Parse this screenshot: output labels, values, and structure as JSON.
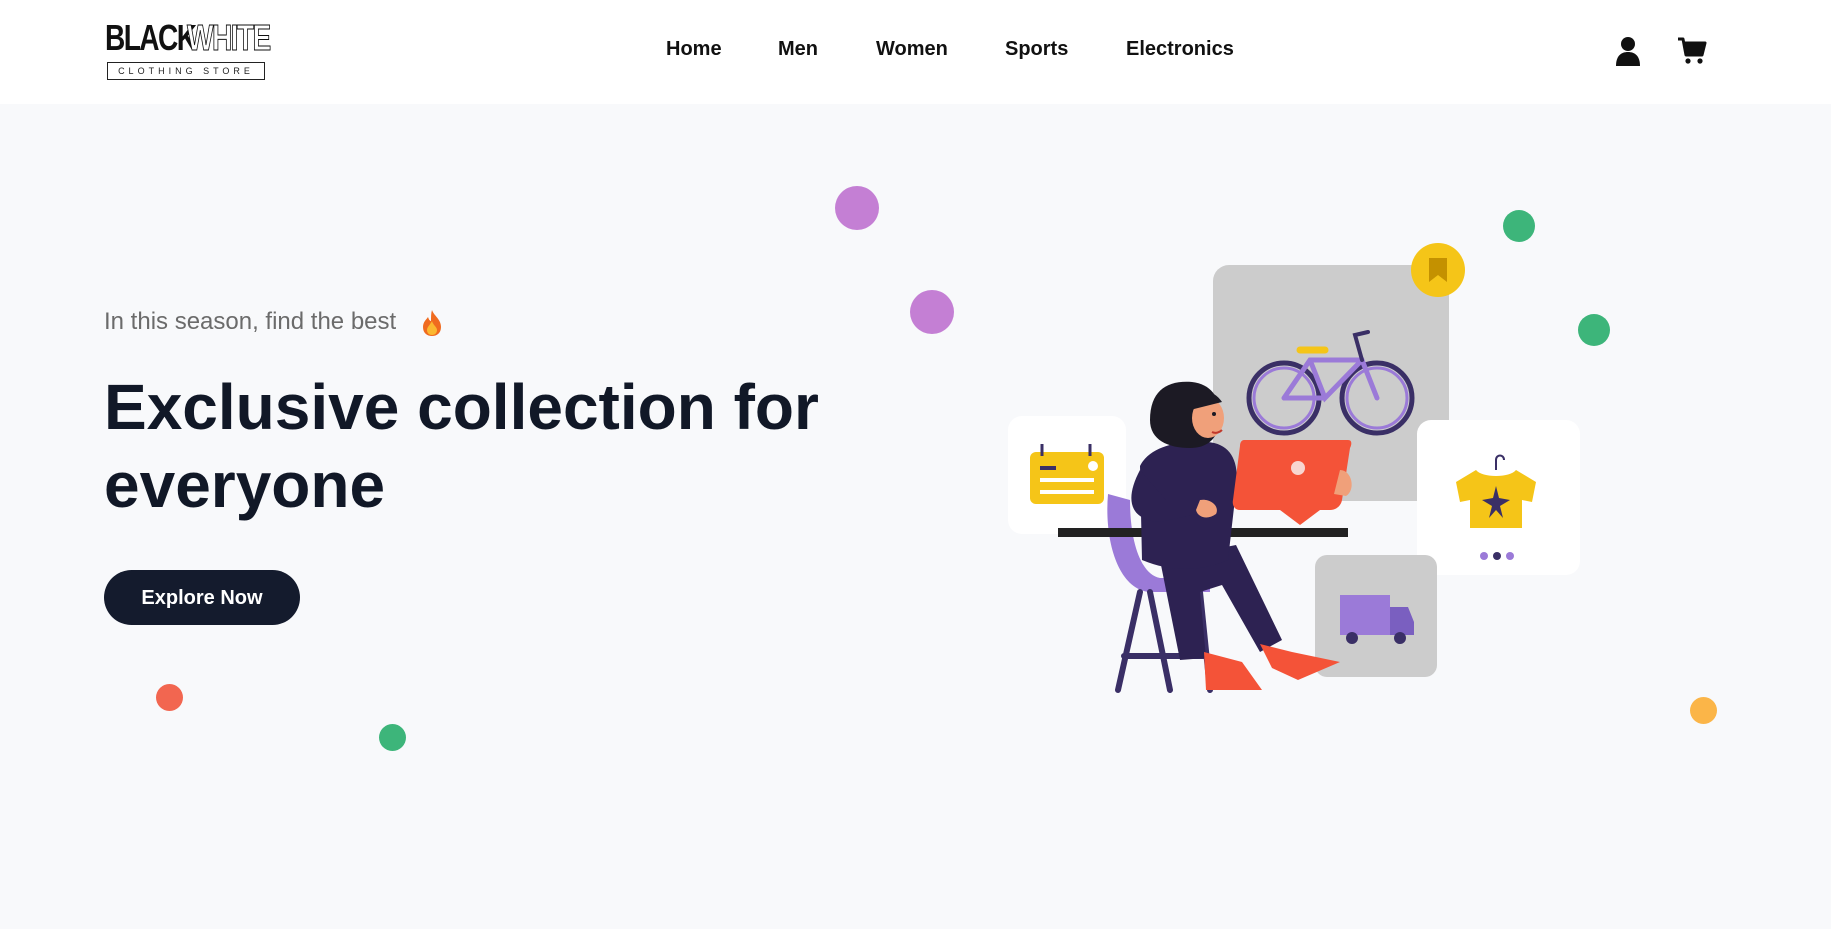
{
  "header": {
    "logo": {
      "word_black": "BLACK",
      "word_white": "WHITE",
      "tagline": "CLOTHING STORE"
    },
    "nav": [
      {
        "label": "Home"
      },
      {
        "label": "Men"
      },
      {
        "label": "Women"
      },
      {
        "label": "Sports"
      },
      {
        "label": "Electronics"
      }
    ],
    "icons": {
      "account": "user-icon",
      "cart": "cart-icon"
    }
  },
  "hero": {
    "eyebrow": "In this season, find the best",
    "eyebrow_icon": "flame-icon",
    "headline": "Exclusive collection for everyone",
    "cta_label": "Explore Now"
  },
  "colors": {
    "background": "#f8f9fb",
    "header_bg": "#ffffff",
    "headline": "#111827",
    "eyebrow": "#6b6b6b",
    "cta_bg": "#141b2d",
    "cta_text": "#ffffff",
    "dot_purple": "#c47fd4",
    "dot_green": "#3db57a",
    "dot_red": "#f26650",
    "dot_orange": "#fbb548",
    "accent_yellow": "#f5c518",
    "accent_red": "#f45338",
    "accent_purple": "#9b7ad8",
    "figure_dark": "#2d2252"
  }
}
